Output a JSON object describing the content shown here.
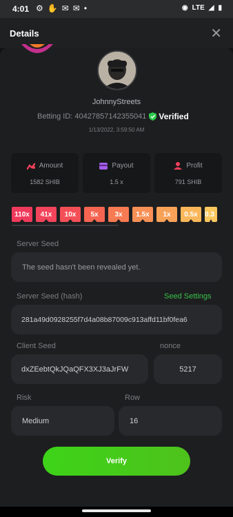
{
  "status_bar": {
    "time": "4:01",
    "network": "LTE"
  },
  "header": {
    "title": "Details",
    "close_glyph": "✕"
  },
  "profile": {
    "username": "JohnnyStreets",
    "betting_id_label": "Betting ID: 40427857142355041",
    "verified_label": "Verified",
    "date": "1/13/2022, 3:59:50 AM"
  },
  "stats": [
    {
      "label": "Amount",
      "value": "1582 SHIB",
      "icon": "amount-icon",
      "color": "#f0405a"
    },
    {
      "label": "Payout",
      "value": "1.5 x",
      "icon": "payout-card-icon",
      "color": "#a35de8"
    },
    {
      "label": "Profit",
      "value": "791 SHIB",
      "icon": "profit-user-icon",
      "color": "#f0405a"
    }
  ],
  "multipliers": [
    {
      "label": "110x",
      "color": "#f03a5c"
    },
    {
      "label": "41x",
      "color": "#f2445b"
    },
    {
      "label": "10x",
      "color": "#f44f57"
    },
    {
      "label": "5x",
      "color": "#f56552"
    },
    {
      "label": "3x",
      "color": "#f67a52"
    },
    {
      "label": "1.5x",
      "color": "#f79055"
    },
    {
      "label": "1x",
      "color": "#f8a258"
    },
    {
      "label": "0.5x",
      "color": "#f9b75a"
    },
    {
      "label": "0.3",
      "color": "#fbc85e"
    }
  ],
  "server_seed": {
    "label": "Server Seed",
    "value": "The seed hasn't been revealed yet."
  },
  "server_seed_hash": {
    "label": "Server Seed (hash)",
    "link": "Seed Settings",
    "value": "281a49d0928255f7d4a08b87009c913affd11bf0fea6"
  },
  "client_seed": {
    "label": "Client Seed",
    "value": "dxZEebtQkJQaQFX3XJ3aJrFW"
  },
  "nonce": {
    "label": "nonce",
    "value": "5217"
  },
  "risk": {
    "label": "Risk",
    "value": "Medium"
  },
  "row": {
    "label": "Row",
    "value": "16"
  },
  "verify_button": {
    "label": "Verify"
  }
}
